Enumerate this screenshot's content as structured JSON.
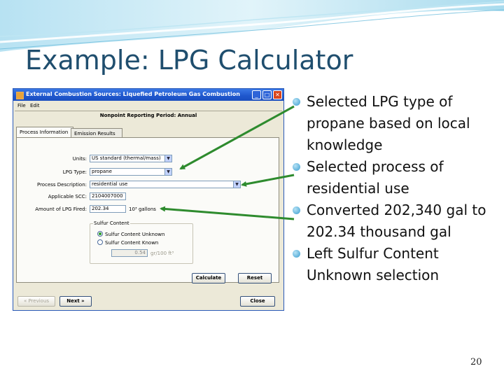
{
  "slide": {
    "title": "Example: LPG Calculator",
    "page_number": "20",
    "accent_color": "#1f4e6e",
    "arrow_color": "#2e8b2e",
    "bullets": [
      "Selected LPG type of propane based on local knowledge",
      "Selected process of residential use",
      "Converted 202,340 gal to 202.34 thousand gal",
      "Left Sulfur Content Unknown selection"
    ]
  },
  "window": {
    "title": "External Combustion Sources: Liquefied Petroleum Gas Combustion",
    "menu": [
      "File",
      "Edit"
    ],
    "period_label": "Nonpoint Reporting Period: Annual",
    "tabs": [
      "Process Information",
      "Emission Results"
    ],
    "active_tab": "Process Information",
    "form": {
      "units_label": "Units:",
      "units_value": "US standard (thermal/mass)",
      "lpg_type_label": "LPG Type:",
      "lpg_type_value": "propane",
      "process_label": "Process Description:",
      "process_value": "residential use",
      "scc_label": "Applicable SCC:",
      "scc_value": "2104007000",
      "amount_label": "Amount of LPG Fired:",
      "amount_value": "202.34",
      "amount_unit": "10³ gallons",
      "sulfur_group_title": "Sulfur Content",
      "sulfur_unknown": "Sulfur Content Unknown",
      "sulfur_known": "Sulfur Content Known",
      "sulfur_selected": "unknown",
      "sulfur_value": "0.54",
      "sulfur_unit": "gr/100 ft³"
    },
    "buttons": {
      "calculate": "Calculate",
      "reset": "Reset",
      "previous": "Previous",
      "next": "Next",
      "close": "Close"
    }
  }
}
